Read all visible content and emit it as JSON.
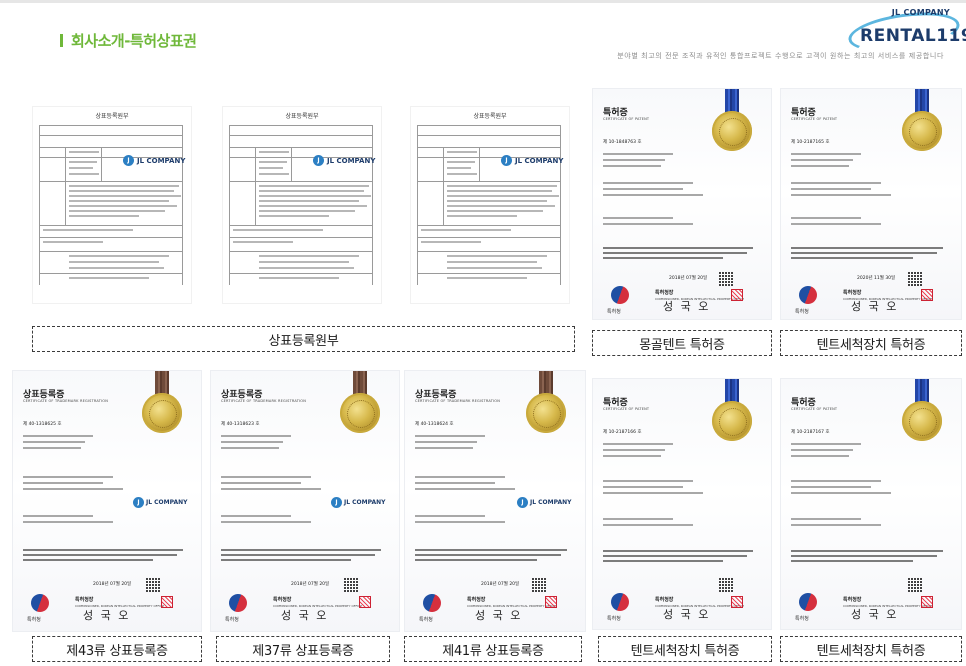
{
  "header": {
    "title": "회사소개-특허상표권",
    "tagline": "분야별 최고의 전문 조직과 유적인 통합프로젝트 수행으로 고객이 원하는 최고의 서비스를 제공합니다",
    "logo": {
      "top": "JL COMPANY",
      "main": "RENTAL119"
    }
  },
  "colors": {
    "accent": "#6fb83a",
    "brand_navy": "#1d3c6b",
    "brand_blue": "#5cb6df"
  },
  "registry": {
    "heading": "상표등록원부",
    "company": "JL COMPANY",
    "caption": "상표등록원부"
  },
  "certs": {
    "patent_title": "특허증",
    "patent_sub": "CERTIFICATE OF PATENT",
    "trademark_title": "상표등록증",
    "trademark_sub": "CERTIFICATE OF TRADEMARK REGISTRATION",
    "kipo": "특허청",
    "kipo_en": "Korean Intellectual Property Office",
    "commissioner": "특허청장",
    "commissioner_en": "COMMISSIONER, KOREAN INTELLECTUAL PROPERTY OFFICE",
    "company": "JL COMPANY",
    "sign": "성 국 오",
    "items": [
      {
        "no": "제 10-1848763 호",
        "date": "2018년 07월 20일",
        "caption": "몽골텐트 특허증"
      },
      {
        "no": "제 10-2187165 호",
        "date": "2020년 11월 30일",
        "caption": "텐트세척장치 특허증"
      },
      {
        "no": "제 40-1318625 호",
        "date": "2018년 07월 20일",
        "caption": "제43류 상표등록증"
      },
      {
        "no": "제 40-1318623 호",
        "date": "2018년 07월 20일",
        "caption": "제37류 상표등록증"
      },
      {
        "no": "제 40-1318624 호",
        "date": "2018년 07월 20일",
        "caption": "제41류 상표등록증"
      },
      {
        "no": "제 10-2187166 호",
        "date": "",
        "caption": "텐트세척장치 특허증"
      },
      {
        "no": "제 10-2187167 호",
        "date": "",
        "caption": "텐트세척장치 특허증"
      }
    ]
  }
}
